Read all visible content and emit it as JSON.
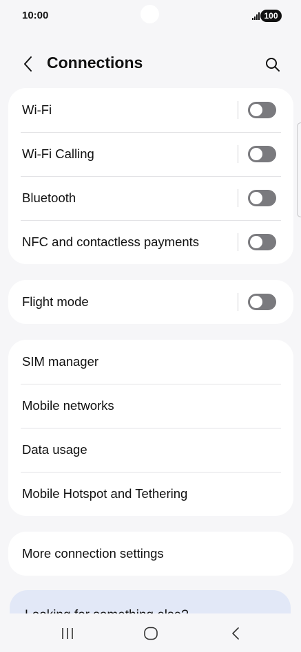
{
  "status_bar": {
    "time": "10:00",
    "battery": "100"
  },
  "header": {
    "title": "Connections"
  },
  "groups": [
    {
      "items": [
        {
          "label": "Wi-Fi",
          "toggle": true,
          "on": false
        },
        {
          "label": "Wi-Fi Calling",
          "toggle": true,
          "on": false
        },
        {
          "label": "Bluetooth",
          "toggle": true,
          "on": false
        },
        {
          "label": "NFC and contactless payments",
          "toggle": true,
          "on": false
        }
      ]
    },
    {
      "items": [
        {
          "label": "Flight mode",
          "toggle": true,
          "on": false
        }
      ]
    },
    {
      "items": [
        {
          "label": "SIM manager"
        },
        {
          "label": "Mobile networks"
        },
        {
          "label": "Data usage"
        },
        {
          "label": "Mobile Hotspot and Tethering"
        }
      ]
    },
    {
      "items": [
        {
          "label": "More connection settings"
        }
      ]
    }
  ],
  "suggestion": {
    "text": "Looking for something else?"
  },
  "colors": {
    "background": "#f6f6f8",
    "card": "#ffffff",
    "toggle_off": "#7a7a7e",
    "suggestion_bg": "#e2e8f7"
  }
}
